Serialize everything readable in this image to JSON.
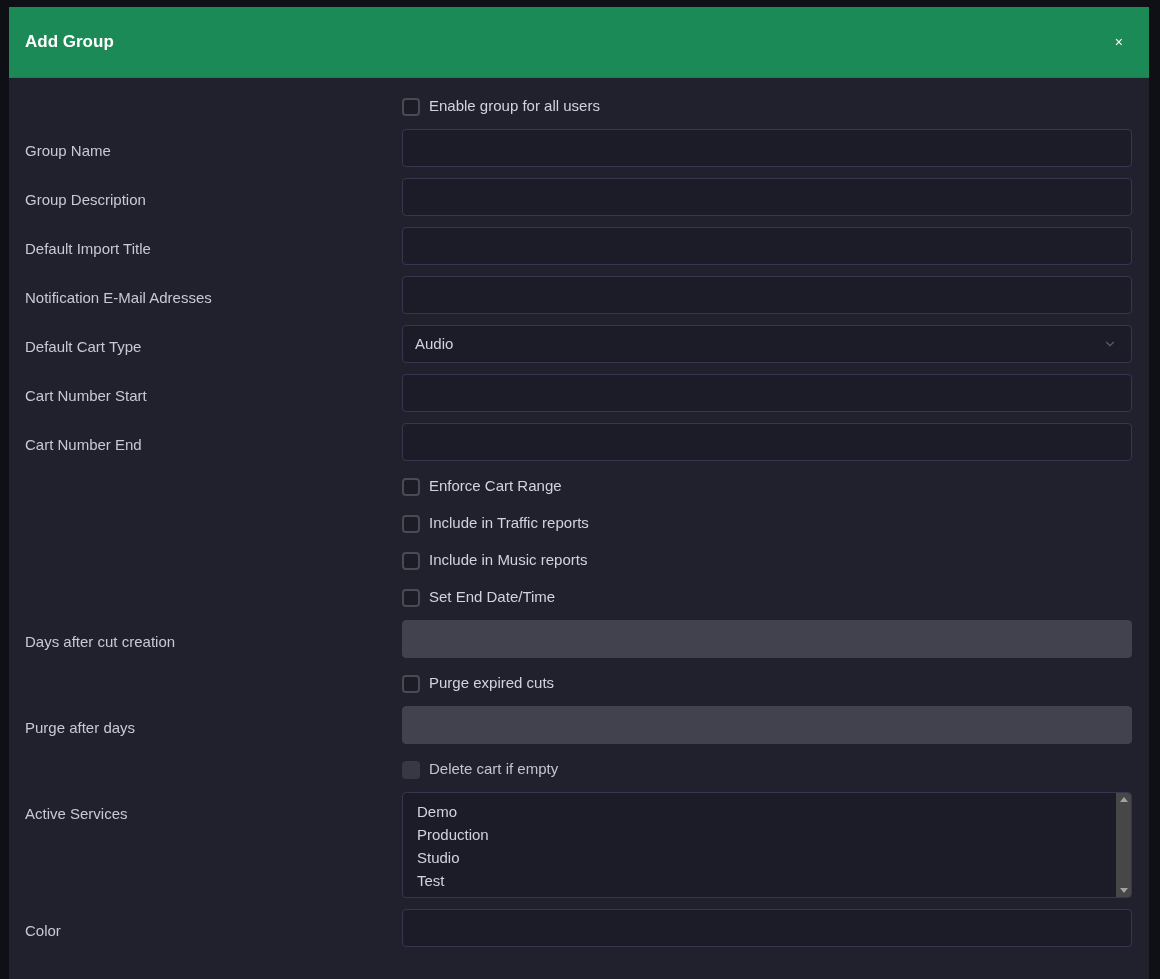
{
  "dialog": {
    "title": "Add Group",
    "close": "×"
  },
  "rows": [
    {
      "kind": "checkbox",
      "text": "Enable group for all users",
      "checked": false,
      "disabled": false
    },
    {
      "kind": "text",
      "label": "Group Name",
      "disabled": false
    },
    {
      "kind": "text",
      "label": "Group Description",
      "disabled": false
    },
    {
      "kind": "text",
      "label": "Default Import Title",
      "disabled": false
    },
    {
      "kind": "text",
      "label": "Notification E-Mail Adresses",
      "disabled": false
    },
    {
      "kind": "select",
      "label": "Default Cart Type",
      "value": "Audio"
    },
    {
      "kind": "text",
      "label": "Cart Number Start",
      "disabled": false
    },
    {
      "kind": "text",
      "label": "Cart Number End",
      "disabled": false
    },
    {
      "kind": "checkbox",
      "text": "Enforce Cart Range",
      "checked": false,
      "disabled": false
    },
    {
      "kind": "checkbox",
      "text": "Include in Traffic reports",
      "checked": false,
      "disabled": false
    },
    {
      "kind": "checkbox",
      "text": "Include in Music reports",
      "checked": false,
      "disabled": false
    },
    {
      "kind": "checkbox",
      "text": "Set End Date/Time",
      "checked": false,
      "disabled": false
    },
    {
      "kind": "text",
      "label": "Days after cut creation",
      "disabled": true
    },
    {
      "kind": "checkbox",
      "text": "Purge expired cuts",
      "checked": false,
      "disabled": false
    },
    {
      "kind": "text",
      "label": "Purge after days",
      "disabled": true
    },
    {
      "kind": "checkbox",
      "text": "Delete cart if empty",
      "checked": false,
      "disabled": true
    },
    {
      "kind": "listbox",
      "label": "Active Services",
      "options": [
        {
          "text": "Demo",
          "selected": false
        },
        {
          "text": "Production",
          "selected": false
        },
        {
          "text": "Studio",
          "selected": false
        },
        {
          "text": "Test",
          "selected": false
        }
      ]
    },
    {
      "kind": "text",
      "label": "Color",
      "disabled": false
    }
  ]
}
